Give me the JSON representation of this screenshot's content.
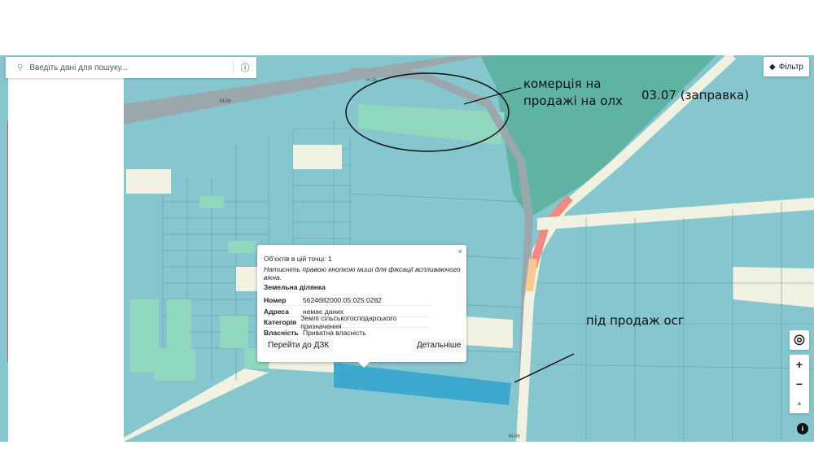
{
  "search": {
    "placeholder": "Введіть дані для пошуку..."
  },
  "filter": {
    "label": "Фільтр"
  },
  "controls": {
    "locate": "◎",
    "zoom_in": "+",
    "zoom_out": "−",
    "compass": "▲",
    "info": "i"
  },
  "road_labels": [
    "M-06",
    "H-25",
    "M-06",
    "H-25"
  ],
  "popup": {
    "close": "×",
    "count": "Об'єктів в цій точці: 1",
    "hint": "Натисніть правою кнопкою миші для фіксації вспливаючого вікна.",
    "section": "Земельна ділянка",
    "rows": [
      {
        "label": "Номер",
        "value": "5624682000:05:025:0282"
      },
      {
        "label": "Адреса",
        "value": "немає даних"
      },
      {
        "label": "Категорія",
        "value": "Землі сільськогосподарського призначення"
      },
      {
        "label": "Власність",
        "value": "Приватна власність"
      }
    ],
    "go_dzk": "Перейти до ДЗК",
    "details": "Детальніше"
  },
  "annotations": {
    "a1": "комерція на",
    "a2": "продажі на олх",
    "a3": "03.07 (заправка)",
    "a4": "під продаж осг"
  },
  "colors": {
    "parcel": "#86c6cf",
    "highlight": "#3ea9cf",
    "green": "#8fd8bd",
    "road": "#f1f1e2"
  }
}
